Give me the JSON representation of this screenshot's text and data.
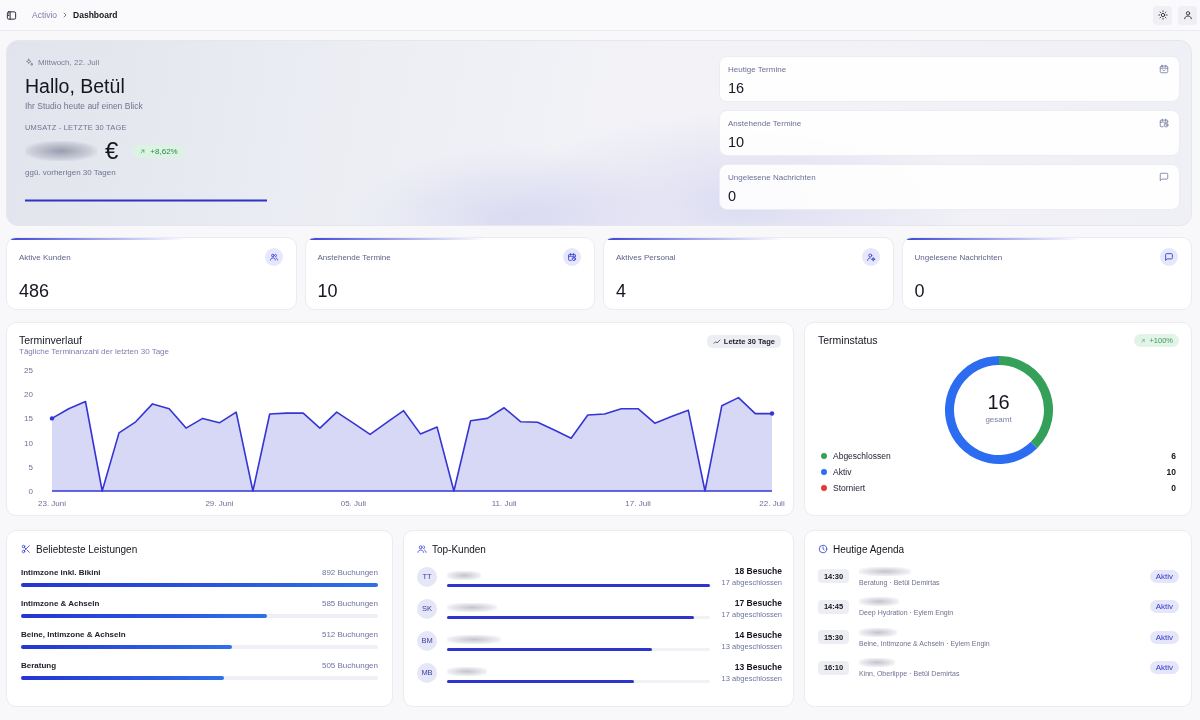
{
  "topbar": {
    "breadcrumb": [
      {
        "label": "Activio",
        "current": false
      },
      {
        "label": "Dashboard",
        "current": true
      }
    ]
  },
  "hero": {
    "date": "Mittwoch, 22. Juli",
    "greeting": "Hallo, Betül",
    "subtitle": "Ihr Studio heute auf einen Blick",
    "revenue_label": "UMSATZ - LETZTE 30 TAGE",
    "currency": "€",
    "change": "+8,62%",
    "comparison": "ggü. vorherigen 30 Tagen",
    "cards": [
      {
        "kind": "today",
        "label": "Heutige Termine",
        "value": "16"
      },
      {
        "kind": "upcoming",
        "label": "Anstehende Termine",
        "value": "10"
      },
      {
        "kind": "messages",
        "label": "Ungelesene Nachrichten",
        "value": "0"
      }
    ]
  },
  "stats": [
    {
      "kind": "clients",
      "label": "Aktive Kunden",
      "value": "486"
    },
    {
      "kind": "upcoming",
      "label": "Anstehende Termine",
      "value": "10"
    },
    {
      "kind": "staff",
      "label": "Aktives Personal",
      "value": "4"
    },
    {
      "kind": "messages",
      "label": "Ungelesene Nachrichten",
      "value": "0"
    }
  ],
  "trend": {
    "title": "Terminverlauf",
    "subtitle": "Tägliche Terminanzahl der letzten 30 Tage",
    "range": "Letzte 30 Tage",
    "chart_data": {
      "type": "area",
      "categories": [
        "23. Juni",
        null,
        null,
        null,
        null,
        null,
        null,
        null,
        null,
        null,
        "29. Juni",
        null,
        null,
        null,
        null,
        null,
        null,
        null,
        "05. Juli",
        null,
        null,
        null,
        null,
        null,
        null,
        null,
        null,
        "11. Juli",
        null,
        null,
        null,
        null,
        null,
        null,
        null,
        "17. Juli",
        null,
        null,
        null,
        null,
        null,
        null,
        null,
        "22. Juli"
      ],
      "series": [
        {
          "color": "#3535d4",
          "values": [
            15,
            17,
            18.5,
            0,
            12,
            14.3,
            18,
            17,
            13,
            15,
            14.1,
            16.3,
            0,
            15.9,
            16.1,
            16.1,
            13,
            16.3,
            14,
            11.7,
            14.2,
            16.6,
            11.8,
            13.2,
            0,
            14.5,
            15,
            17.2,
            14.3,
            14.2,
            12.6,
            10.9,
            15.7,
            15.9,
            17,
            17,
            14,
            15.4,
            16.7,
            0,
            17.6,
            19.3,
            16,
            16
          ]
        }
      ],
      "ylim": [
        0,
        25
      ],
      "yticks": [
        0,
        5,
        10,
        15,
        20,
        25
      ]
    }
  },
  "status": {
    "title": "Terminstatus",
    "change": "+100%",
    "total": "16",
    "total_label": "gesamt",
    "chart_data": {
      "type": "donut",
      "values": [
        37.5,
        62.5,
        0
      ]
    },
    "legend": [
      {
        "label": "Abgeschlossen",
        "count": "6",
        "color": "#34a05a"
      },
      {
        "label": "Aktiv",
        "count": "10",
        "color": "#2b6cf0"
      },
      {
        "label": "Storniert",
        "count": "0",
        "color": "#e5393b"
      }
    ]
  },
  "services": {
    "title": "Beliebteste Leistungen",
    "items": [
      {
        "name": "Intimzone inkl. Bikini",
        "count": "892 Buchungen",
        "level": 1
      },
      {
        "name": "Intimzone & Achseln",
        "count": "585 Buchungen",
        "level": 0.69
      },
      {
        "name": "Beine, Intimzone & Achseln",
        "count": "512 Buchungen",
        "level": 0.59
      },
      {
        "name": "Beratung",
        "count": "505 Buchungen",
        "level": 0.57
      }
    ]
  },
  "top_clients": {
    "title": "Top-Kunden",
    "items": [
      {
        "initials": "TT",
        "visits": "18 Besuche",
        "completed": "17 abgeschlossen",
        "level": 1
      },
      {
        "initials": "SK",
        "visits": "17 Besuche",
        "completed": "17 abgeschlossen",
        "level": 0.94
      },
      {
        "initials": "BM",
        "visits": "14 Besuche",
        "completed": "13 abgeschlossen",
        "level": 0.78
      },
      {
        "initials": "MB",
        "visits": "13 Besuche",
        "completed": "13 abgeschlossen",
        "level": 0.71
      }
    ]
  },
  "agenda": {
    "title": "Heutige Agenda",
    "items": [
      {
        "time": "14:30",
        "detail": "Beratung · Betül Demirtas",
        "status": "Aktiv"
      },
      {
        "time": "14:45",
        "detail": "Deep Hydration · Eylem Engin",
        "status": "Aktiv"
      },
      {
        "time": "15:30",
        "detail": "Beine, Intimzone & Achseln · Eylem Engin",
        "status": "Aktiv"
      },
      {
        "time": "16:10",
        "detail": "Kinn, Oberlippe · Betül Demirtas",
        "status": "Aktiv"
      }
    ]
  }
}
